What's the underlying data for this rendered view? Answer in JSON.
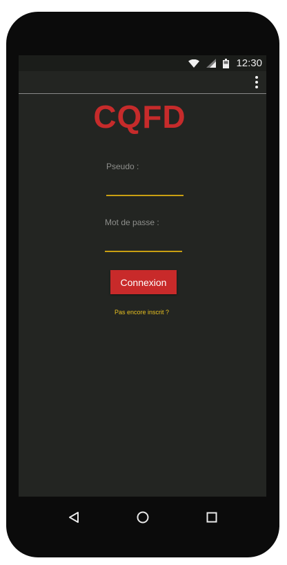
{
  "status_bar": {
    "time": "12:30",
    "icons": [
      "wifi-icon",
      "signal-icon",
      "battery-icon"
    ]
  },
  "app_bar": {
    "menu_icon": "overflow-menu-icon"
  },
  "logo": {
    "text": "CQFD",
    "color": "#c62b2b"
  },
  "form": {
    "pseudo_label": "Pseudo :",
    "pseudo_value": "",
    "pseudo_placeholder": "",
    "password_label": "Mot de passe :",
    "password_value": "",
    "password_placeholder": "",
    "submit_label": "Connexion",
    "register_link": "Pas encore inscrit ?"
  },
  "colors": {
    "background": "#232522",
    "accent_underline": "#c9a012",
    "button": "#c82a2a",
    "link": "#e7c021"
  },
  "nav_bar": {
    "icons": [
      "back-icon",
      "home-icon",
      "recents-icon"
    ]
  }
}
